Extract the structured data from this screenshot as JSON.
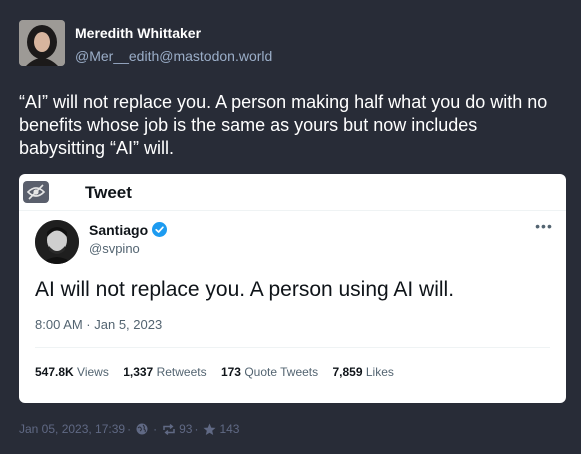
{
  "author": {
    "display_name": "Meredith Whittaker",
    "handle": "@Mer__edith@mastodon.world"
  },
  "status_text": "“AI” will not replace you. A person making half what you do with no benefits whose job is the same as yours but now includes babysitting “AI” will.",
  "embed": {
    "header": "Tweet",
    "tweet": {
      "name": "Santiago",
      "handle": "@svpino",
      "text": "AI will not replace you. A person using AI will.",
      "timestamp": "8:00 AM · Jan 5, 2023",
      "stats": {
        "views_count": "547.8K",
        "views_label": "Views",
        "retweets_count": "1,337",
        "retweets_label": "Retweets",
        "quotes_count": "173",
        "quotes_label": "Quote Tweets",
        "likes_count": "7,859",
        "likes_label": "Likes"
      }
    }
  },
  "footer": {
    "timestamp": "Jan 05, 2023, 17:39",
    "boosts": "93",
    "favourites": "143"
  },
  "colors": {
    "background": "#282c37",
    "handle": "#9baec8",
    "footer": "#606984",
    "verified": "#1d9bf0"
  },
  "icons": [
    "globe-icon",
    "boost-icon",
    "star-icon",
    "eye-slash-icon",
    "verified-icon",
    "more-icon"
  ]
}
